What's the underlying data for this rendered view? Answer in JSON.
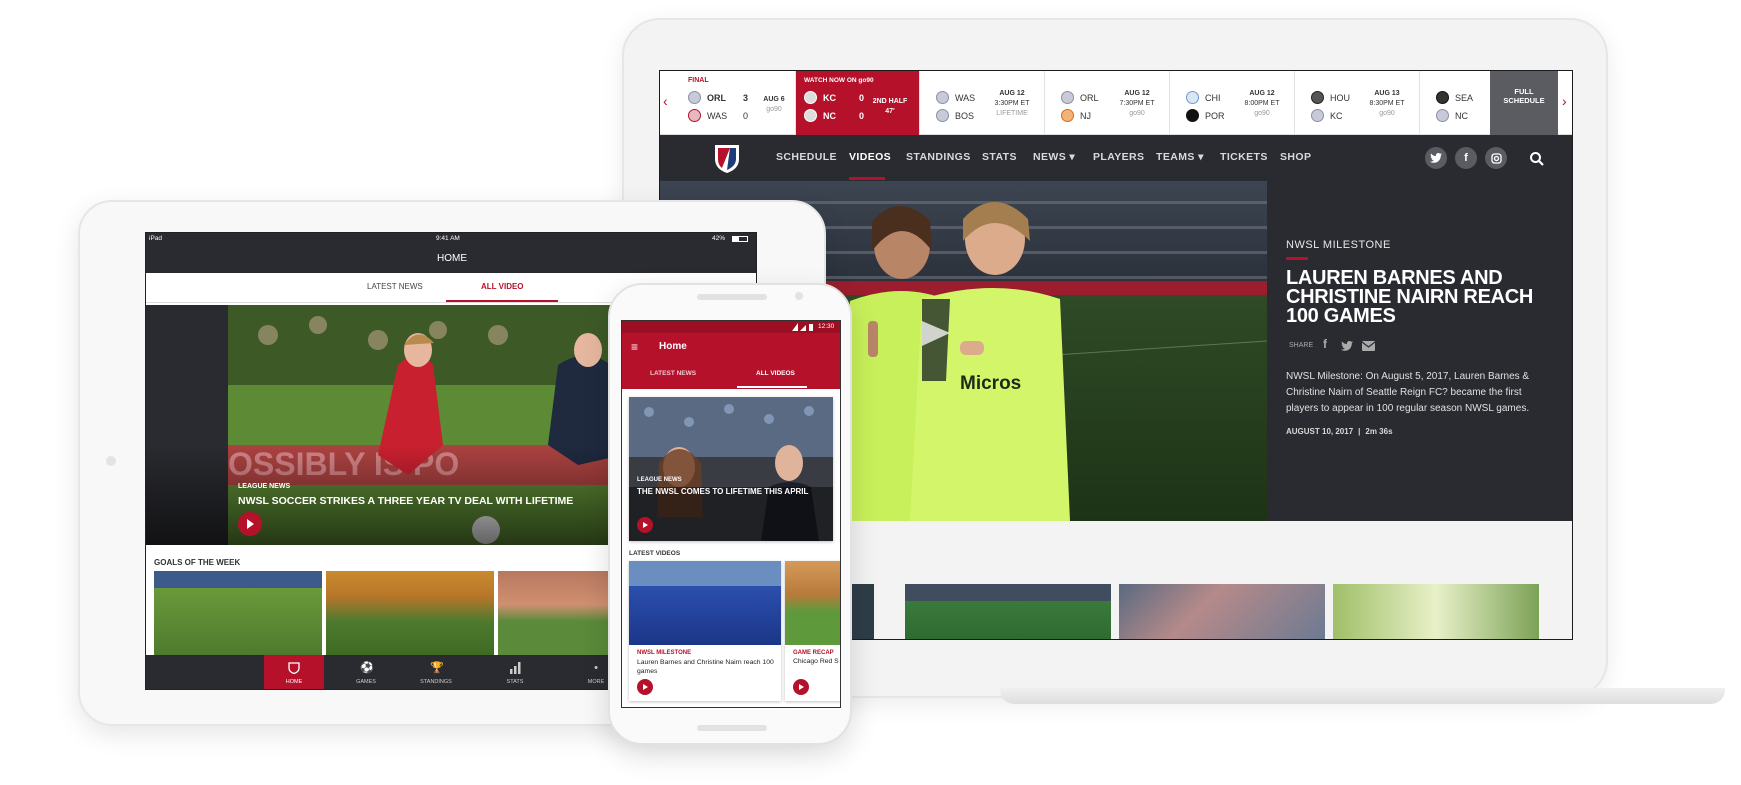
{
  "laptop": {
    "ticker": {
      "final": {
        "status": "FINAL",
        "home": "ORL",
        "home_score": "3",
        "away": "WAS",
        "away_score": "0",
        "date": "AUG 6",
        "network": "go90"
      },
      "live": {
        "status": "WATCH NOW ON go90",
        "home": "KC",
        "home_score": "0",
        "away": "NC",
        "away_score": "0",
        "period": "2ND HALF",
        "clock": "47'"
      },
      "upcoming": [
        {
          "home": "WAS",
          "away": "BOS",
          "date": "AUG 12",
          "time": "3:30PM ET",
          "network": "LIFETIME"
        },
        {
          "home": "ORL",
          "away": "NJ",
          "date": "AUG 12",
          "time": "7:30PM ET",
          "network": "go90"
        },
        {
          "home": "CHI",
          "away": "POR",
          "date": "AUG 12",
          "time": "8:00PM ET",
          "network": "go90"
        },
        {
          "home": "HOU",
          "away": "KC",
          "date": "AUG 13",
          "time": "8:30PM ET",
          "network": "go90"
        },
        {
          "home": "SEA",
          "away": "NC",
          "date": "",
          "time": "",
          "network": ""
        }
      ],
      "full_schedule": "FULL SCHEDULE",
      "prev_arrow": "‹",
      "next_arrow": "›"
    },
    "nav": {
      "items": [
        "SCHEDULE",
        "VIDEOS",
        "STANDINGS",
        "STATS",
        "NEWS ▾",
        "PLAYERS",
        "TEAMS ▾",
        "TICKETS",
        "SHOP"
      ],
      "active_index": 1,
      "social": [
        "twitter-icon",
        "facebook-icon",
        "instagram-icon"
      ],
      "search_icon": "search-icon"
    },
    "hero": {
      "category": "NWSL MILESTONE",
      "headline": "LAUREN BARNES AND CHRISTINE NAIRN REACH 100 GAMES",
      "share_label": "SHARE",
      "description": "NWSL Milestone: On August 5, 2017, Lauren Barnes & Christine Nairn of Seattle Reign FC? became the first players to appear in 100 regular season NWSL games.",
      "date": "AUGUST 10, 2017",
      "separator": "|",
      "duration": "2m 36s",
      "shirt_text": "Micros"
    },
    "accent_color": "#b5112a",
    "nav_bg": "#2a2b30"
  },
  "tablet": {
    "status_left": "iPad",
    "status_time": "9:41 AM",
    "status_battery": "42%",
    "title": "HOME",
    "tabs": [
      "LATEST NEWS",
      "ALL VIDEO"
    ],
    "active_tab": 1,
    "hero_category": "LEAGUE NEWS",
    "hero_title": "NWSL SOCCER STRIKES A THREE YEAR TV DEAL WITH LIFETIME",
    "section_title": "GOALS OF THE WEEK",
    "bottom_nav": [
      "HOME",
      "GAMES",
      "STANDINGS",
      "STATS",
      "MORE"
    ],
    "bottom_nav_icons": [
      "nwsl-shield-icon",
      "soccer-ball-icon",
      "trophy-icon",
      "bar-chart-icon",
      "more-icon"
    ],
    "active_bottom": 0
  },
  "phone": {
    "status_time": "12:30",
    "title": "Home",
    "tabs": [
      "LATEST NEWS",
      "ALL VIDEOS"
    ],
    "active_tab": 1,
    "featured_category": "LEAGUE NEWS",
    "featured_title": "THE NWSL COMES TO LIFETIME THIS APRIL",
    "section_title": "LATEST VIDEOS",
    "videos": [
      {
        "category": "NWSL MILESTONE",
        "title": "Lauren Barnes and Christine Nairn reach 100 games"
      },
      {
        "category": "GAME RECAP",
        "title": "Chicago Red S"
      }
    ]
  }
}
